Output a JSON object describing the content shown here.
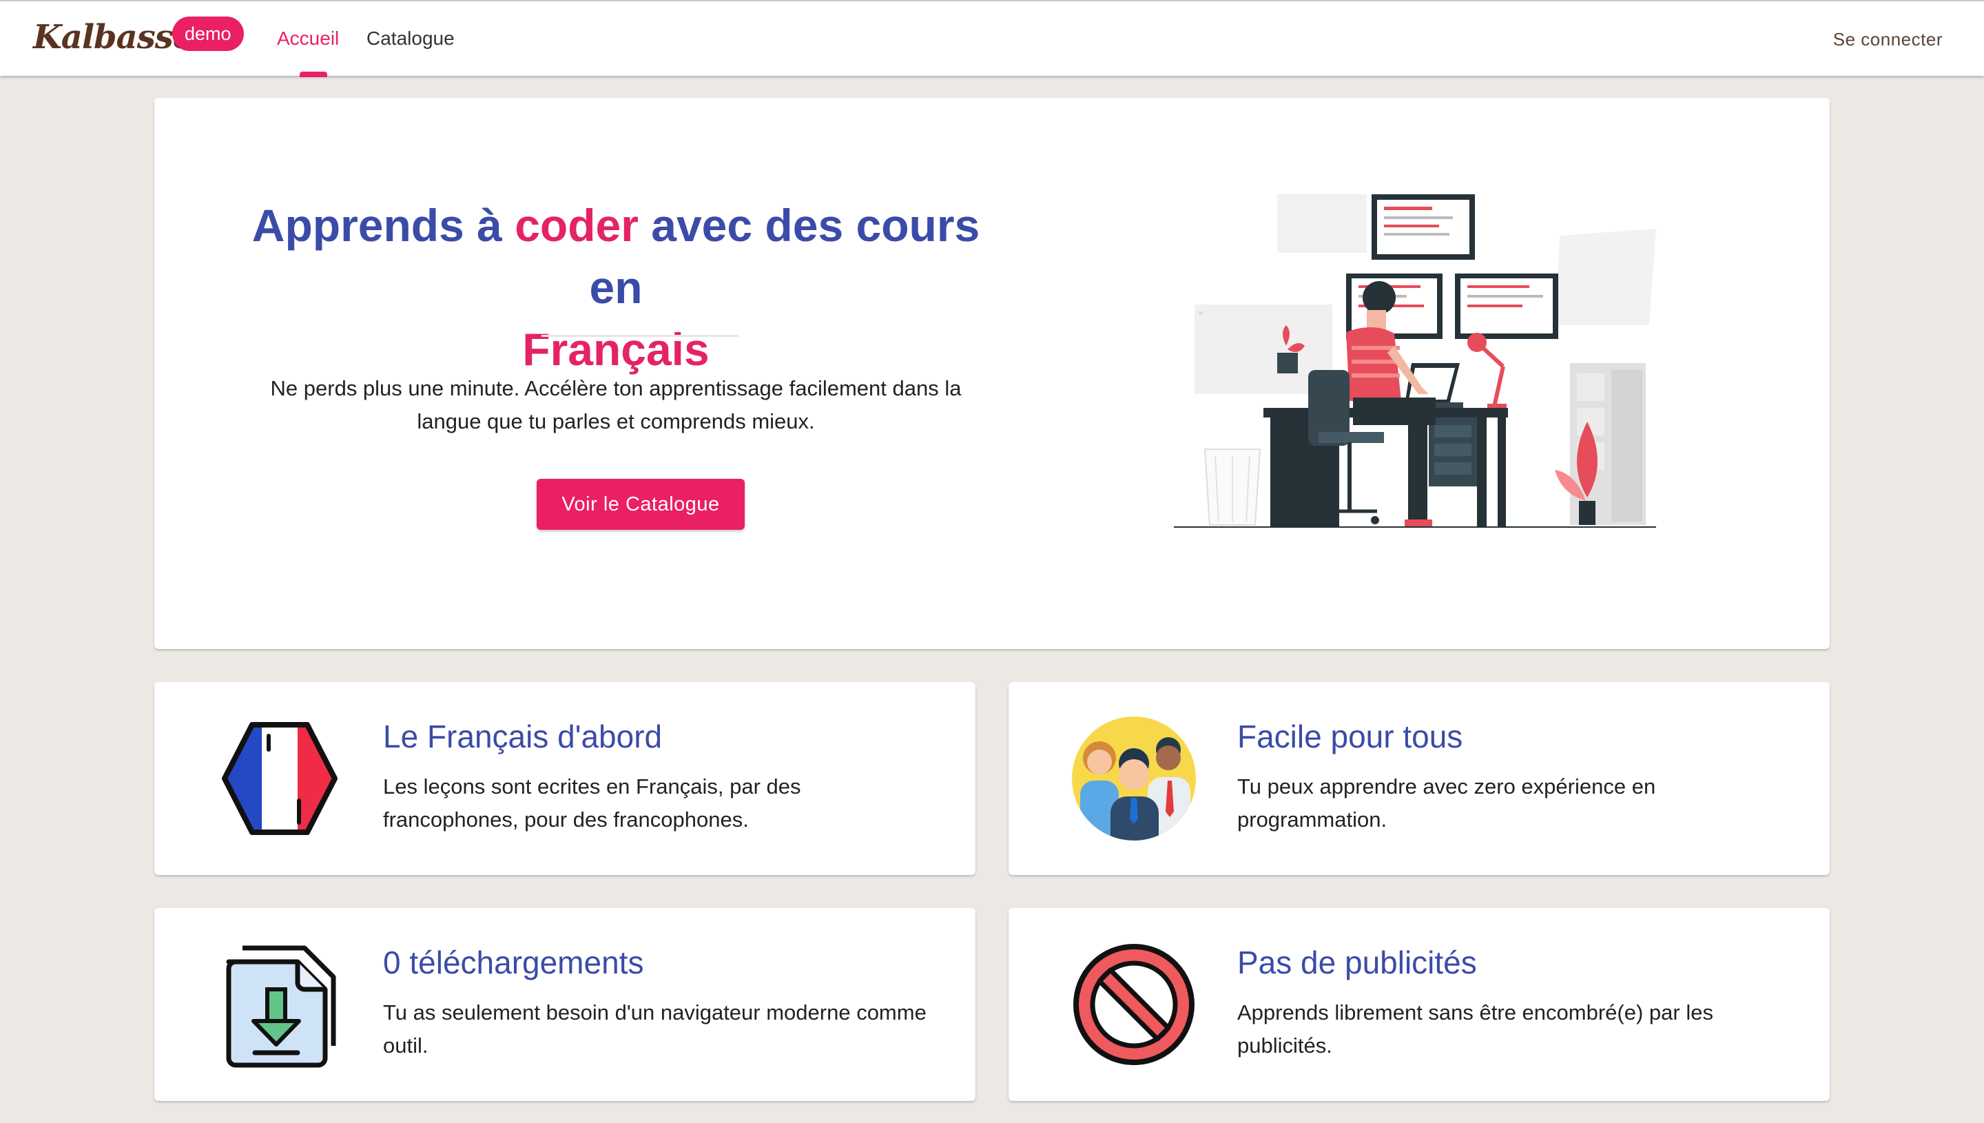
{
  "header": {
    "logo": "Kalbasse",
    "badge": "demo",
    "nav": [
      {
        "label": "Accueil",
        "active": true
      },
      {
        "label": "Catalogue",
        "active": false
      }
    ],
    "login": "Se connecter"
  },
  "hero": {
    "title_part1": "Apprends à ",
    "title_highlight1": "coder",
    "title_part2": " avec des cours en ",
    "title_highlight2": "Français",
    "description": "Ne perds plus une minute. Accélère ton apprentissage facilement dans la langue que tu parles et comprends mieux.",
    "button": "Voir le Catalogue"
  },
  "features": [
    {
      "title": "Le Français d'abord",
      "text": "Les leçons sont ecrites en Français, par des francophones, pour des francophones.",
      "icon": "french-flag-icon"
    },
    {
      "title": "Facile pour tous",
      "text": "Tu peux apprendre avec zero expérience en programmation.",
      "icon": "people-group-icon"
    },
    {
      "title": "0 téléchargements",
      "text": "Tu as seulement besoin d'un navigateur moderne comme outil.",
      "icon": "download-file-icon"
    },
    {
      "title": "Pas de publicités",
      "text": "Apprends librement sans être encombré(e) par les publicités.",
      "icon": "no-ads-icon"
    }
  ],
  "colors": {
    "accent": "#ea1f64",
    "primary": "#3b4ba8",
    "background": "#ece9e5",
    "logo": "#5a3321"
  }
}
